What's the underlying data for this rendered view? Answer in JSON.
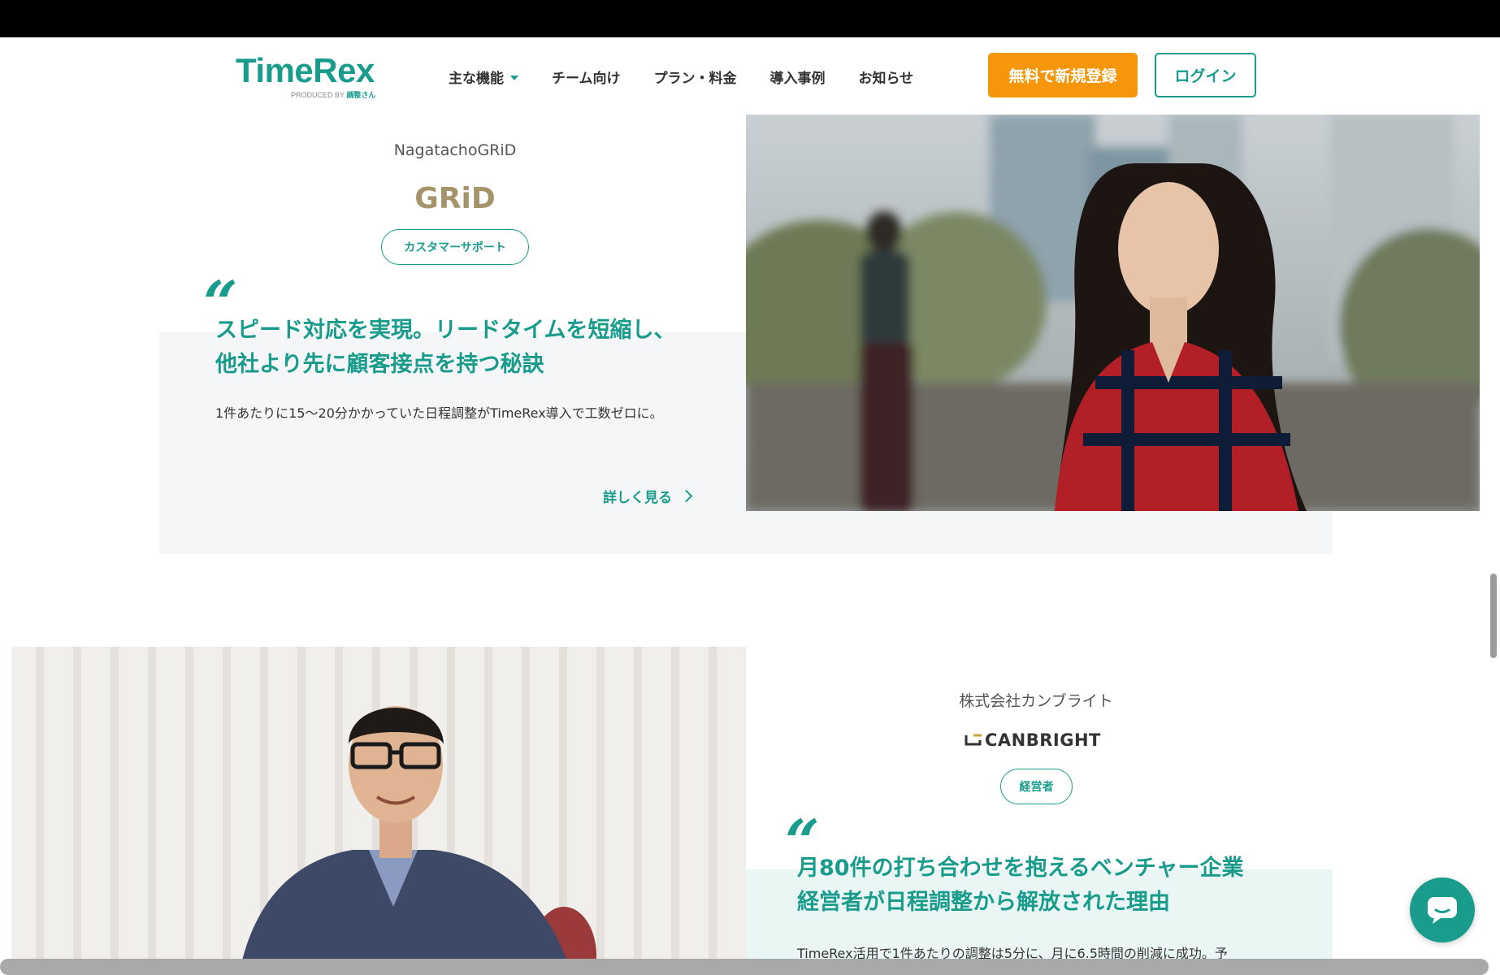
{
  "header": {
    "logo": {
      "text": "TimeRex",
      "produced_by": "PRODUCED BY",
      "produced_name": "調整さん"
    },
    "nav": [
      {
        "label": "主な機能",
        "has_dropdown": true
      },
      {
        "label": "チーム向け"
      },
      {
        "label": "プラン・料金"
      },
      {
        "label": "導入事例"
      },
      {
        "label": "お知らせ"
      }
    ],
    "signup_label": "無料で新規登録",
    "login_label": "ログイン"
  },
  "cases": [
    {
      "company": "NagatachoGRiD",
      "logo_text": "GRiD",
      "tag": "カスタマーサポート",
      "quote_mark": "“",
      "headline_line1": "スピード対応を実現。リードタイムを短縮し、",
      "headline_line2": "他社より先に顧客接点を持つ秘訣",
      "body": "1件あたりに15〜20分かかっていた日程調整がTimeRex導入で工数ゼロに。",
      "more_label": "詳しく見る"
    },
    {
      "company": "株式会社カンブライト",
      "logo_text": "CANBRIGHT",
      "tag": "経営者",
      "quote_mark": "“",
      "headline_line1": "月80件の打ち合わせを抱えるベンチャー企業",
      "headline_line2": "経営者が日程調整から解放された理由",
      "body": "TimeRex活用で1件あたりの調整は5分に、月に6.5時間の削減に成功。予"
    }
  ],
  "colors": {
    "brand": "#1a9c8c",
    "accent": "#f6960b"
  },
  "icons": {
    "chat": "chat-bubble-icon",
    "chevron": "chevron-right-icon",
    "caret": "caret-down-icon"
  }
}
